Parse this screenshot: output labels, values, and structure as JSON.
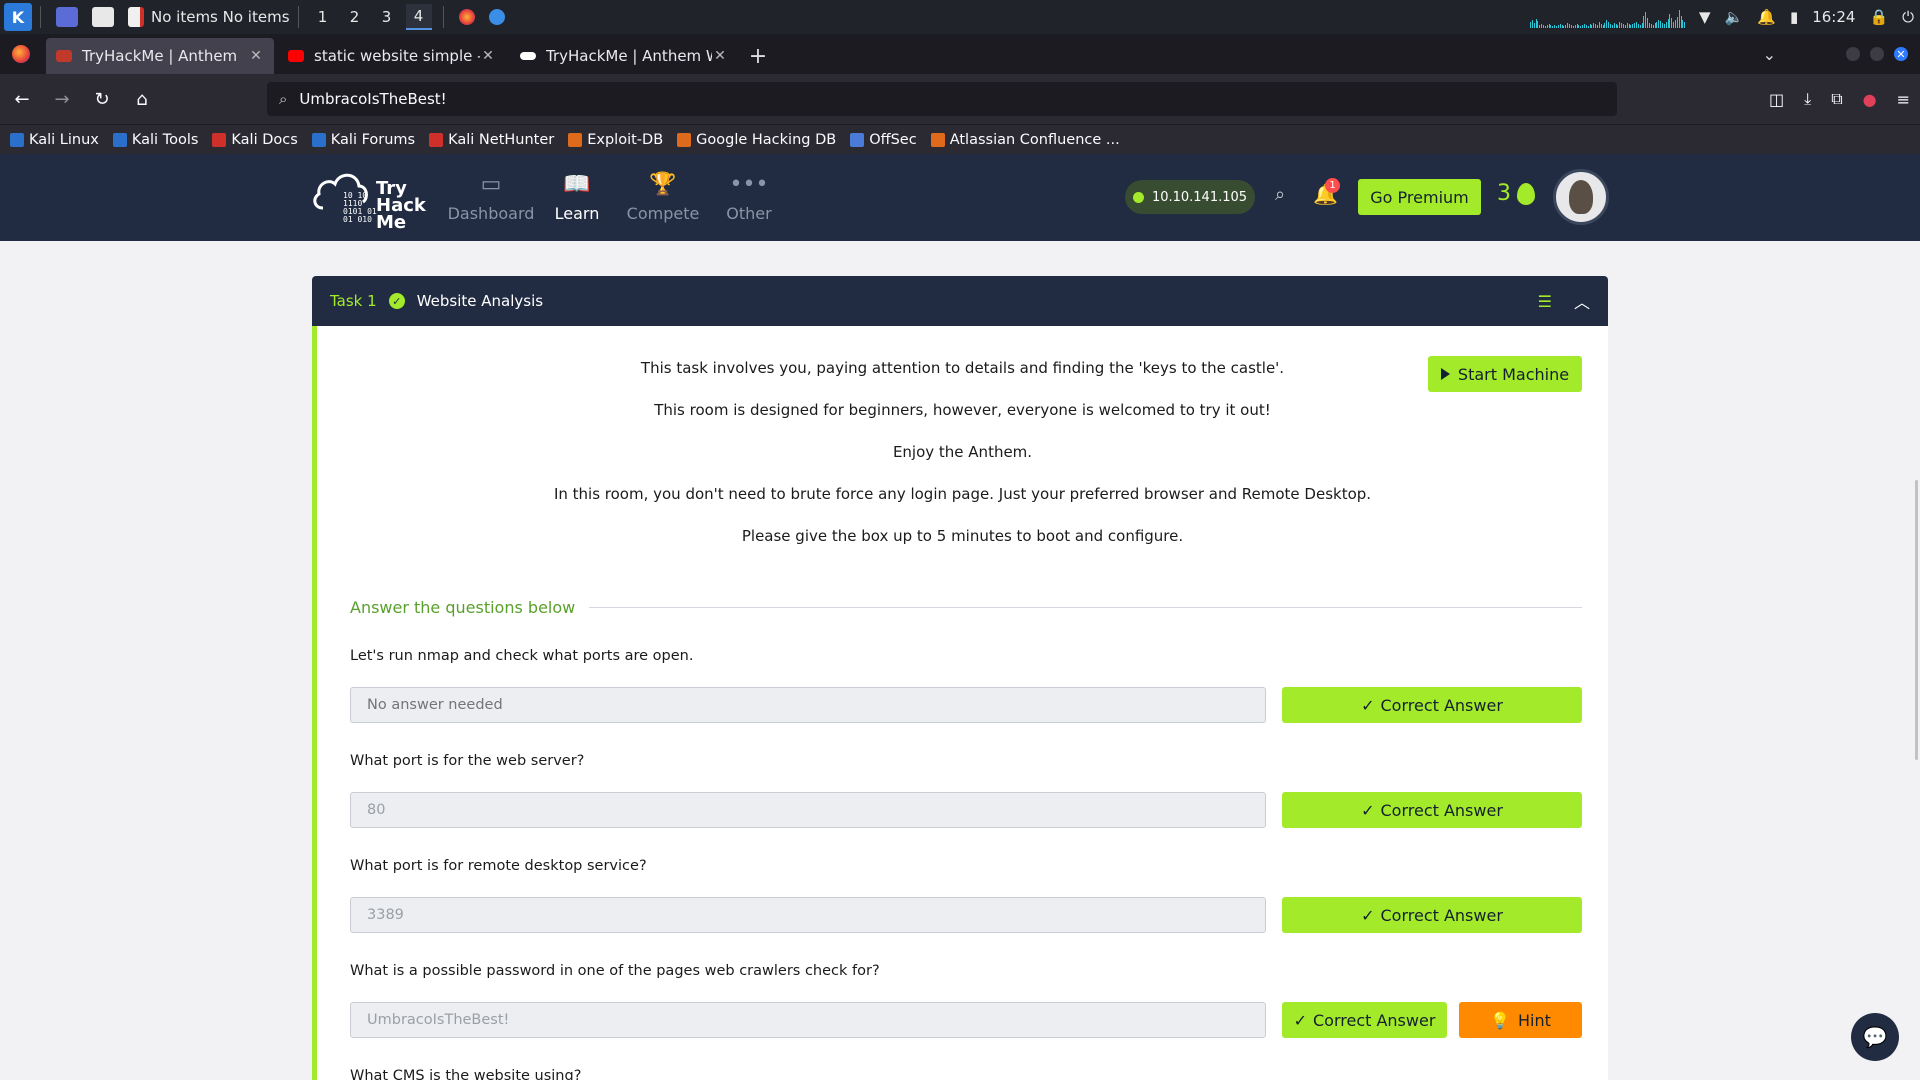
{
  "os_panel": {
    "app_label": "No items No items",
    "workspaces": [
      "1",
      "2",
      "3",
      "4"
    ],
    "active_workspace": "4",
    "clock": "16:24"
  },
  "browser": {
    "tabs": [
      {
        "title": "TryHackMe | Anthem",
        "active": true,
        "favicon_color": "#c0392b"
      },
      {
        "title": "static website simple - Yo",
        "active": false,
        "favicon_color": "#ff0000"
      },
      {
        "title": "TryHackMe | Anthem Writ",
        "active": false,
        "favicon_color": "#ffffff"
      }
    ],
    "url": "UmbracoIsTheBest!",
    "bookmarks": [
      {
        "label": "Kali Linux",
        "color": "#2a6fc9"
      },
      {
        "label": "Kali Tools",
        "color": "#2a6fc9"
      },
      {
        "label": "Kali Docs",
        "color": "#d0302a"
      },
      {
        "label": "Kali Forums",
        "color": "#2a6fc9"
      },
      {
        "label": "Kali NetHunter",
        "color": "#d0302a"
      },
      {
        "label": "Exploit-DB",
        "color": "#e06a1b"
      },
      {
        "label": "Google Hacking DB",
        "color": "#e06a1b"
      },
      {
        "label": "OffSec",
        "color": "#4a7bd8"
      },
      {
        "label": "Atlassian Confluence ...",
        "color": "#e06a1b"
      }
    ]
  },
  "thm": {
    "logo_text": [
      "Try",
      "Hack",
      "Me"
    ],
    "nav": [
      {
        "label": "Dashboard",
        "icon": "dashboard-icon",
        "glyph": "▭",
        "active": false
      },
      {
        "label": "Learn",
        "icon": "book-icon",
        "glyph": "📖",
        "active": true
      },
      {
        "label": "Compete",
        "icon": "trophy-icon",
        "glyph": "🏆",
        "active": false
      },
      {
        "label": "Other",
        "icon": "more-icon",
        "glyph": "•••",
        "active": false
      }
    ],
    "machine_ip": "10.10.141.105",
    "notification_count": "1",
    "premium_label": "Go Premium",
    "streak": "3",
    "accent": "#a3ea2a",
    "header_bg": "#212c42"
  },
  "task": {
    "number": "Task 1",
    "title": "Website Analysis",
    "start_machine_label": "Start Machine",
    "description": [
      "This task involves you, paying attention to details and finding the 'keys to the castle'.",
      "This room is designed for beginners, however, everyone is welcomed to try it out!",
      "Enjoy the Anthem.",
      "In this room, you don't need to brute force any login page. Just your preferred browser and Remote Desktop.",
      "Please give the box up to 5 minutes to boot and configure."
    ],
    "answer_heading": "Answer the questions below",
    "questions": [
      {
        "text": "Let's run nmap and check what ports are open.",
        "answer": "",
        "placeholder": "No answer needed",
        "button": "Correct Answer"
      },
      {
        "text": "What port is for the web server?",
        "answer": "80",
        "placeholder": "",
        "button": "Correct Answer"
      },
      {
        "text": "What port is for remote desktop service?",
        "answer": "3389",
        "placeholder": "",
        "button": "Correct Answer"
      },
      {
        "text": "What is a possible password in one of the pages web crawlers check for?",
        "answer": "UmbracoIsTheBest!",
        "placeholder": "",
        "button": "Correct Answer",
        "hint": "Hint"
      },
      {
        "text": "What CMS is the website using?"
      }
    ]
  }
}
